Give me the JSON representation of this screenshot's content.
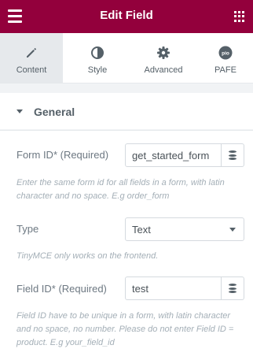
{
  "header": {
    "title": "Edit Field",
    "menu_icon": "hamburger-menu-icon",
    "apps_icon": "grid-apps-icon",
    "background": "#93003c"
  },
  "tabs": [
    {
      "label": "Content",
      "icon": "pencil-icon",
      "active": true
    },
    {
      "label": "Style",
      "icon": "half-circle-icon",
      "active": false
    },
    {
      "label": "Advanced",
      "icon": "gear-icon",
      "active": false
    },
    {
      "label": "PAFE",
      "icon": "pafe-logo-icon",
      "active": false
    }
  ],
  "section": {
    "title": "General",
    "expanded": true
  },
  "fields": {
    "form_id": {
      "label": "Form ID* (Required)",
      "value": "get_started_form",
      "description": "Enter the same form id for all fields in a form, with latin character and no space. E.g order_form"
    },
    "type": {
      "label": "Type",
      "value": "Text",
      "description": "TinyMCE only works on the frontend."
    },
    "field_id": {
      "label": "Field ID* (Required)",
      "value": "test",
      "description": "Field ID have to be unique in a form, with latin character and no space, no number. Please do not enter Field ID = product. E.g your_field_id"
    }
  }
}
